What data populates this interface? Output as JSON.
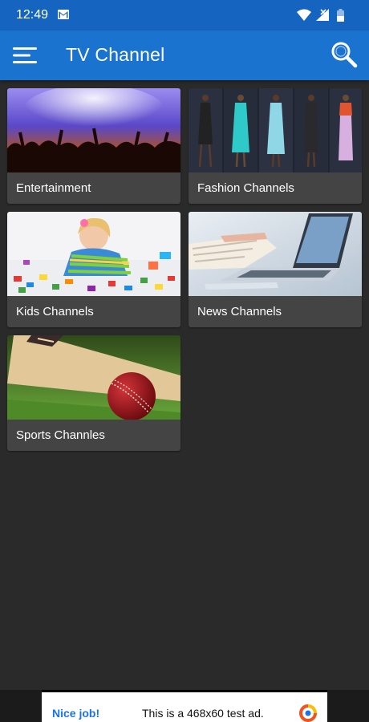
{
  "status_bar": {
    "time": "12:49",
    "notification_icon": "gmail-icon",
    "icons": [
      "wifi-icon",
      "signal-icon",
      "battery-icon"
    ]
  },
  "app_bar": {
    "title": "TV Channel",
    "menu_icon": "hamburger-menu-icon",
    "search_icon": "search-icon",
    "colors": {
      "status": "#1565c0",
      "bar": "#1a73cf"
    }
  },
  "categories": [
    {
      "label": "Entertainment",
      "image": "concert-crowd-image"
    },
    {
      "label": "Fashion Channels",
      "image": "fashion-runway-image"
    },
    {
      "label": "Kids Channels",
      "image": "child-playing-blocks-image"
    },
    {
      "label": "News Channels",
      "image": "newspaper-laptop-image"
    },
    {
      "label": "Sports Channles",
      "image": "cricket-ball-bat-image"
    }
  ],
  "ad": {
    "headline": "Nice job!",
    "message": "This is a 468x60 test ad.",
    "icon": "adchoices-logo-icon"
  },
  "theme": {
    "background": "#2a2a2a",
    "card": "#444444"
  }
}
